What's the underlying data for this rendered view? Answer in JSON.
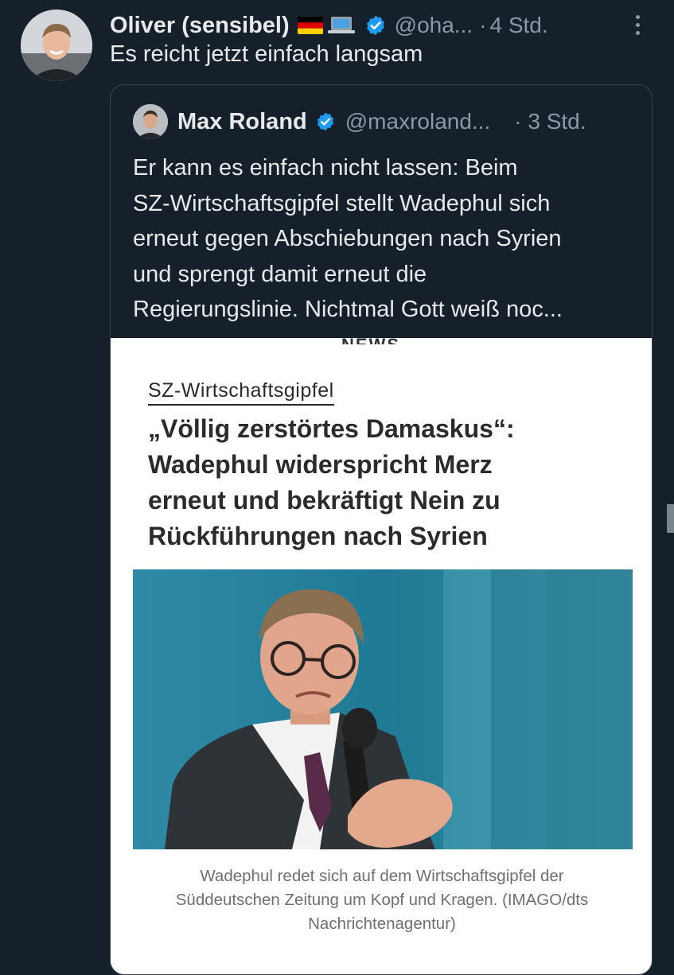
{
  "author": {
    "name": "Oliver (sensibel)",
    "handle": "@oha...",
    "time": "4 Std."
  },
  "tweet": {
    "text": "Es reicht jetzt einfach langsam"
  },
  "quoted": {
    "name": "Max Roland",
    "handle": "@maxroland...",
    "time": "3 Std.",
    "text_lines": [
      "Er kann es einfach nicht lassen: Beim",
      "SZ-Wirtschaftsgipfel stellt Wadephul sich",
      "erneut gegen Abschiebungen nach Syrien",
      "und sprengt damit erneut die",
      "Regierungslinie. Nichtmal Gott weiß noc..."
    ]
  },
  "article": {
    "top_clip": "NEWS",
    "kicker": "SZ-Wirtschaftsgipfel",
    "headline_lines": [
      "„Völlig zerstörtes Damaskus“:",
      "Wadephul widerspricht Merz",
      "erneut und bekräftigt Nein zu",
      "Rückführungen nach Syrien"
    ],
    "caption_lines": [
      "Wadephul redet sich auf dem Wirtschaftsgipfel der",
      "Süddeutschen Zeitung um Kopf und Kragen. (IMAGO/dts",
      "Nachrichtenagentur)"
    ]
  },
  "colors": {
    "background": "#15202b",
    "text": "#e7e9ea",
    "muted": "#8b98a5",
    "verified": "#1d9bf0",
    "border": "#38444d"
  }
}
